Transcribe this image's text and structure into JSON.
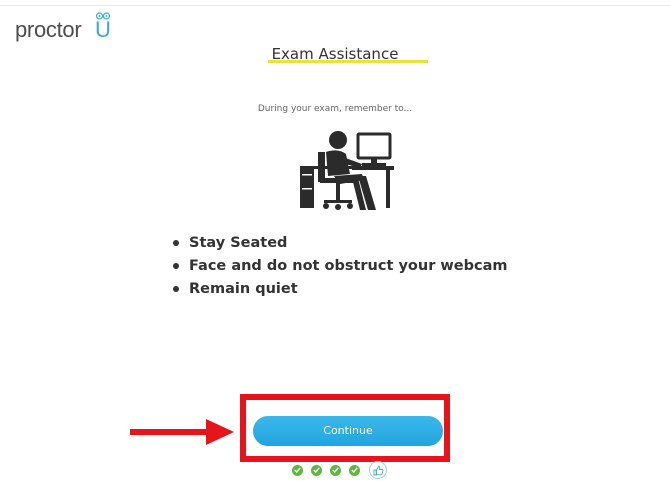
{
  "app": {
    "logo_text": "proctor",
    "logo_u": "U",
    "brand_color": "#3aa9d3"
  },
  "header": {
    "title": "Exam Assistance",
    "underline_color": "#e9e23c"
  },
  "main": {
    "subtitle": "During your exam, remember to...",
    "illustration_icon": "person-seated-at-desk-icon",
    "rules": [
      "Stay Seated",
      "Face and do not obstruct your webcam",
      "Remain quiet"
    ]
  },
  "footer": {
    "continue_label": "Continue",
    "button_color": "#2aaee5",
    "annotation_color": "#e8141b",
    "progress": {
      "completed_steps": 4,
      "current_step": 5,
      "total_steps": 5,
      "completed_icon": "check-icon",
      "current_icon": "thumbs-up-icon"
    }
  }
}
